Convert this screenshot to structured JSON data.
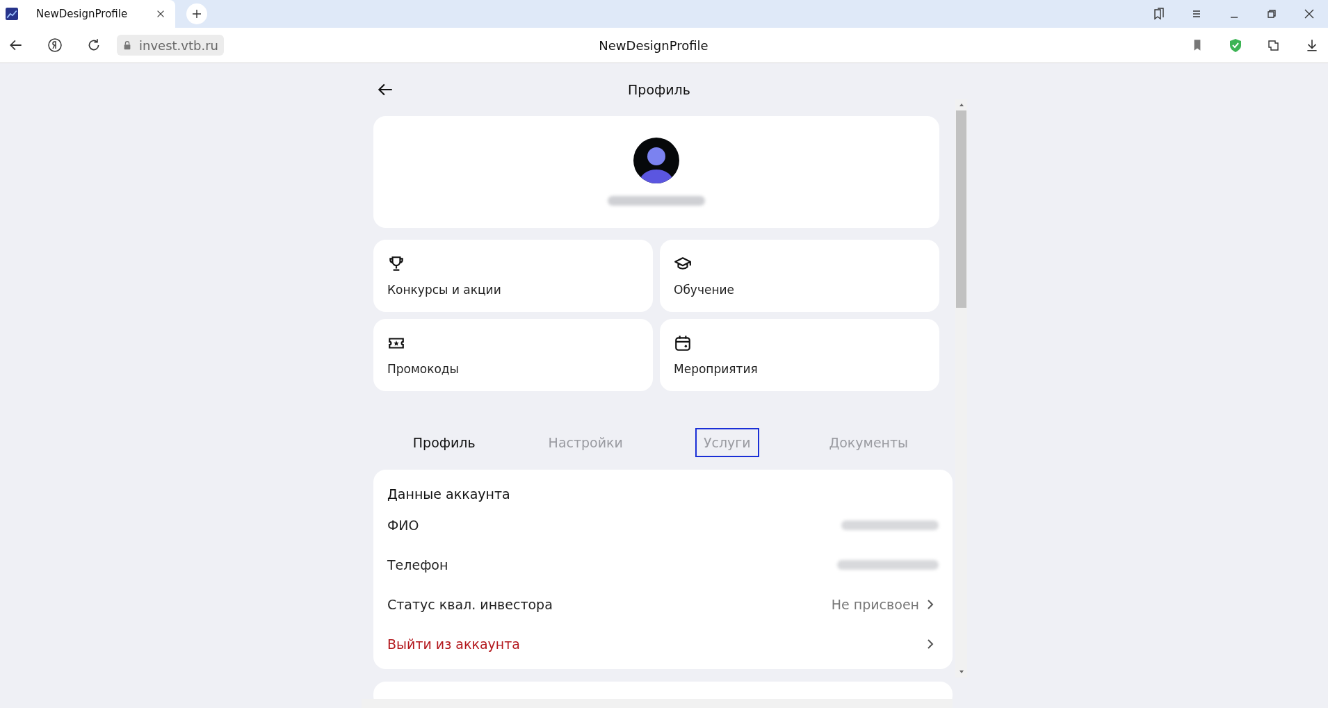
{
  "browser": {
    "tab_title": "NewDesignProfile",
    "url": "invest.vtb.ru",
    "page_title": "NewDesignProfile"
  },
  "header": {
    "title": "Профиль"
  },
  "tiles": [
    {
      "label": "Конкурсы и акции",
      "kind": "trophy"
    },
    {
      "label": "Обучение",
      "kind": "education"
    },
    {
      "label": "Промокоды",
      "kind": "ticket"
    },
    {
      "label": "Мероприятия",
      "kind": "calendar"
    }
  ],
  "tabs": [
    {
      "label": "Профиль",
      "selected": true,
      "focused": false
    },
    {
      "label": "Настройки",
      "selected": false,
      "focused": false
    },
    {
      "label": "Услуги",
      "selected": false,
      "focused": true
    },
    {
      "label": "Документы",
      "selected": false,
      "focused": false
    }
  ],
  "account": {
    "title": "Данные аккаунта",
    "rows": [
      {
        "kind": "hidden",
        "label": "ФИО",
        "chevron": false
      },
      {
        "kind": "hidden",
        "label": "Телефон",
        "chevron": false
      },
      {
        "kind": "plain",
        "label": "Статус квал. инвестора",
        "value": "Не присвоен",
        "chevron": true
      },
      {
        "kind": "danger",
        "label": "Выйти из аккаунта",
        "chevron": true
      }
    ]
  }
}
